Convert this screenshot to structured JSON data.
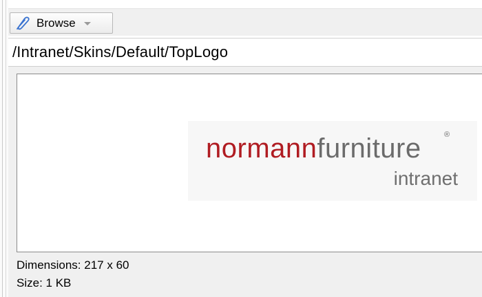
{
  "toolbar": {
    "browse_label": "Browse",
    "browse_icon": "link-icon",
    "caret_icon": "chevron-down-icon"
  },
  "path": {
    "value": "/Intranet/Skins/Default/TopLogo"
  },
  "preview": {
    "logo_primary": "normann",
    "logo_secondary": "furniture",
    "logo_mark": "®",
    "logo_tagline": "intranet",
    "brand_red": "#b01c22",
    "brand_gray": "#6b6b6b"
  },
  "info": {
    "dimensions": "Dimensions: 217 x 60",
    "size": "Size: 1 KB"
  }
}
